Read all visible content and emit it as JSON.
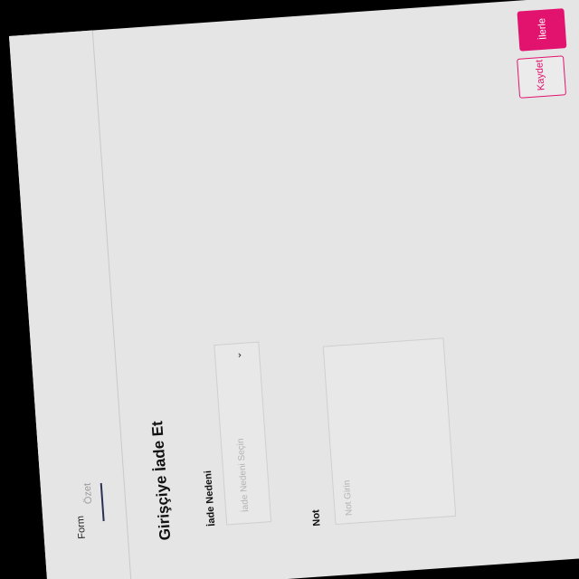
{
  "tabs": [
    {
      "label": "Form",
      "active": true
    },
    {
      "label": "Özet",
      "active": false
    }
  ],
  "form": {
    "title": "Girişçiye İade Et",
    "reason": {
      "label": "İade Nedeni",
      "placeholder": "İade Nedeni Seçin"
    },
    "note": {
      "label": "Not",
      "placeholder": "Not Girin"
    }
  },
  "actions": {
    "primary_label": "İlerle",
    "secondary_label": "Kaydet"
  },
  "colors": {
    "accent": "#e2136e",
    "tab_indicator": "#2c2f56",
    "panel_bg": "#e5e5e5"
  },
  "icons": {
    "select_chevron": "chevron-down-icon"
  }
}
